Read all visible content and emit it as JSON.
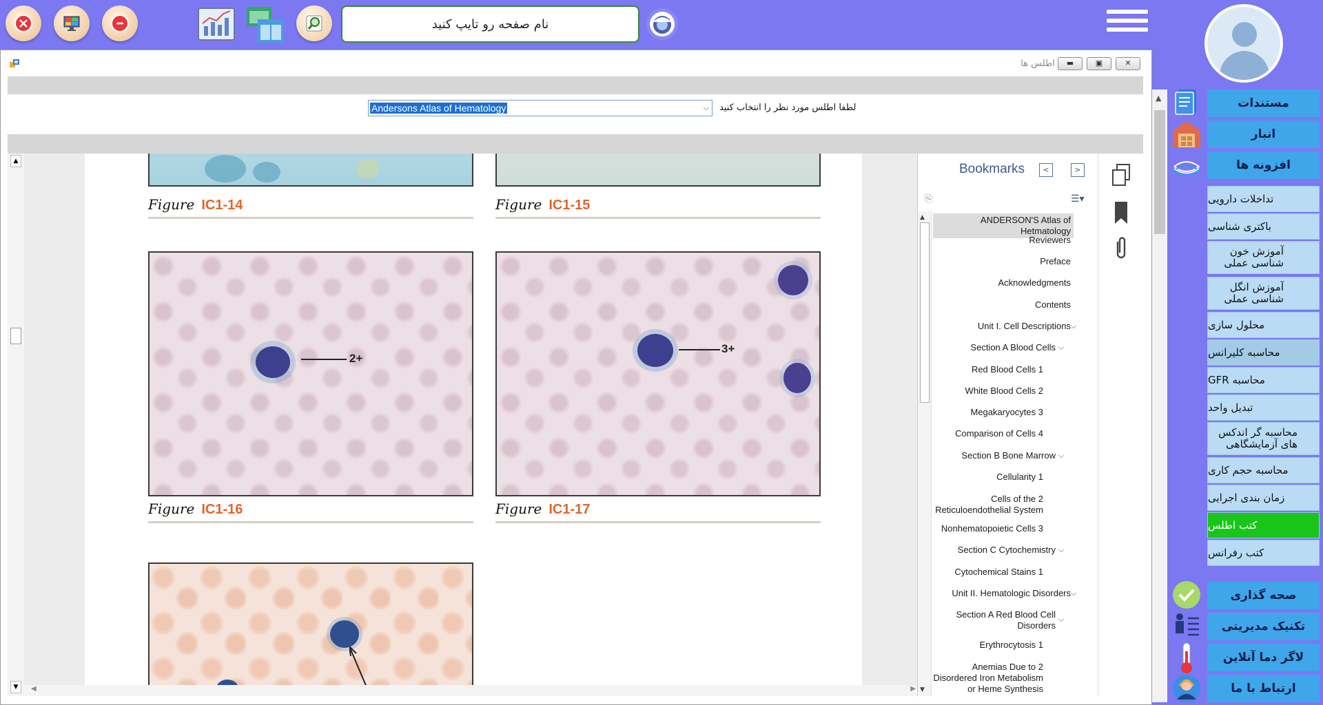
{
  "topbar": {
    "search_placeholder": "نام صفحه رو تایپ کنید",
    "icons": [
      "close-icon",
      "monitor-icon",
      "minus-icon",
      "chart-icon",
      "windows-icon",
      "magnifier-icon",
      "eye-icon",
      "hamburger-menu-icon"
    ]
  },
  "window": {
    "title": "اطلس ها",
    "controls": [
      "minimize",
      "restore",
      "close"
    ],
    "selector_label": "لطفا اطلس مورد نظر را انتخاب کنید",
    "selected_atlas": "Andersons Atlas of Hematology"
  },
  "document": {
    "figures": [
      {
        "word": "Figure",
        "num": "IC1-14"
      },
      {
        "word": "Figure",
        "num": "IC1-15"
      },
      {
        "word": "Figure",
        "num": "IC1-16",
        "arrow_label": "2+"
      },
      {
        "word": "Figure",
        "num": "IC1-17",
        "arrow_label": "3+"
      }
    ]
  },
  "bookmarks": {
    "title": "Bookmarks",
    "items": [
      "ANDERSON'S Atlas of Hetmatology",
      "Reviewers",
      "Preface",
      "Acknowledgments",
      "Contents",
      "Unit I. Cell Descriptions",
      "Section A Blood Cells",
      "Red Blood Cells 1",
      "White Blood Cells 2",
      "Megakaryocytes 3",
      "Comparison of Cells 4",
      "Section B Bone Marrow",
      "Cellularity 1",
      "Cells of the 2",
      "Reticuloendothelial System",
      "Nonhematopoietic Cells 3",
      "Section C Cytochemistry",
      "Cytochemical Stains 1",
      "Unit II. Hematologic Disorders",
      "Section A Red Blood Cell",
      "Disorders",
      "Erythrocytosis 1",
      "Anemias Due to 2",
      "Disordered Iron Metabolism",
      "or Heme Synthesis"
    ]
  },
  "sidebar": {
    "buttons": [
      "مستندات",
      "انبار",
      "افزونه ها",
      "تداخلات دارویی",
      "باکتری شناسی",
      "آموزش خون شناسی عملی",
      "آموزش انگل شناسی عملی",
      "محلول سازی",
      "محاسبه کلیرانس",
      "محاسبه GFR",
      "تبدیل واحد",
      "محاسبه گر اندکس های آزمایشگاهی",
      "محاسبه حجم کاری",
      "زمان بندی اجرایی",
      "کتب اطلس",
      "کتب رفرانس",
      "صحه گذاری",
      "تکنیک مدیریتی",
      "لاگر دما آنلاین",
      "ارتباط با ما"
    ],
    "active": "کتب اطلس"
  },
  "colors": {
    "background": "#7b78f2",
    "sidebar_big_button": "#3fa6e9",
    "sidebar_small_button": "#b9dcf4",
    "active_button": "#18c518",
    "figure_number": "#e2652a"
  }
}
